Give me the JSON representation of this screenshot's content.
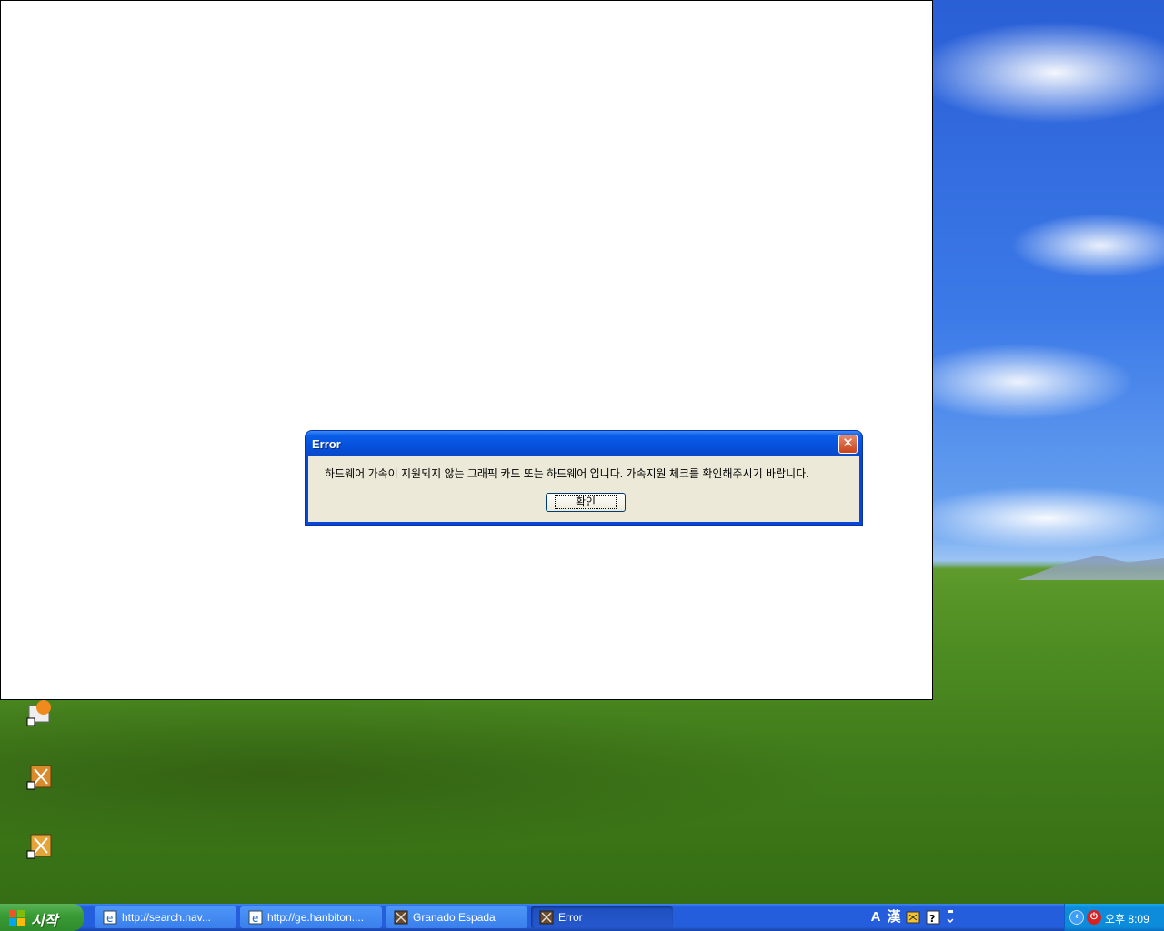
{
  "dialog": {
    "title": "Error",
    "message": "하드웨어 가속이 지원되지 않는 그래픽 카드 또는 하드웨어 입니다. 가속지원 체크를 확인해주시기 바랍니다.",
    "ok_label": "확인",
    "close_glyph": "✕"
  },
  "taskbar": {
    "start_label": "시작",
    "tasks": [
      {
        "label": "http://search.nav...",
        "icon": "ie-icon"
      },
      {
        "label": "http://ge.hanbiton....",
        "icon": "ie-icon"
      },
      {
        "label": "Granado Espada",
        "icon": "game-icon"
      },
      {
        "label": "Error",
        "icon": "game-icon"
      }
    ],
    "ime": {
      "mode_a": "A",
      "mode_han": "漢"
    },
    "clock": "오후 8:09"
  },
  "colors": {
    "titlebar": "#0a5ee8",
    "dialog_face": "#ece9d8",
    "start_green": "#3a9d36",
    "taskbar_blue": "#245edc",
    "close_red": "#c8421a"
  }
}
